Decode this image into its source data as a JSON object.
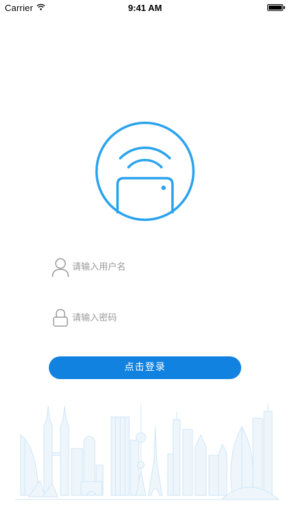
{
  "status_bar": {
    "carrier": "Carrier",
    "time": "9:41 AM",
    "wifi_icon": "wifi-icon",
    "battery_icon": "battery-icon"
  },
  "logo": {
    "icon": "wifi-device-logo-icon",
    "color": "#2aa3ee"
  },
  "form": {
    "username": {
      "placeholder": "请输入用户名",
      "value": "",
      "icon": "user-icon"
    },
    "password": {
      "placeholder": "请输入密码",
      "value": "",
      "icon": "lock-icon"
    },
    "login_label": "点击登录"
  },
  "colors": {
    "primary": "#1182e0",
    "accent": "#2aa3ee",
    "placeholder": "#9a9a9a",
    "skyline": "#cfe6f6"
  },
  "background": {
    "illustration": "city-skyline-illustration"
  }
}
